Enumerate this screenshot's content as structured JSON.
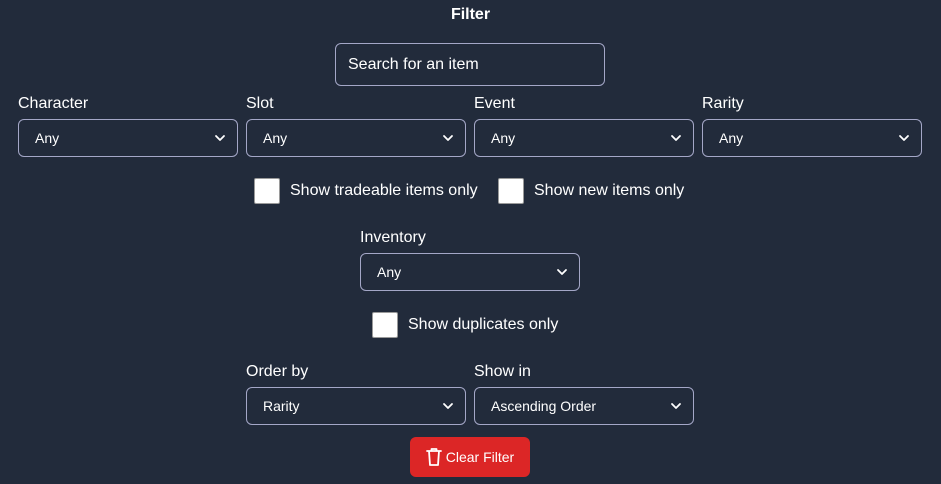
{
  "title": "Filter",
  "search": {
    "placeholder": "Search for an item",
    "value": ""
  },
  "filters": {
    "character": {
      "label": "Character",
      "value": "Any"
    },
    "slot": {
      "label": "Slot",
      "value": "Any"
    },
    "event": {
      "label": "Event",
      "value": "Any"
    },
    "rarity": {
      "label": "Rarity",
      "value": "Any"
    }
  },
  "checkboxes": {
    "tradeable": {
      "label": "Show tradeable items only",
      "checked": false
    },
    "new_items": {
      "label": "Show new items only",
      "checked": false
    },
    "duplicates": {
      "label": "Show duplicates only",
      "checked": false
    }
  },
  "inventory": {
    "label": "Inventory",
    "value": "Any"
  },
  "order_by": {
    "label": "Order by",
    "value": "Rarity"
  },
  "show_in": {
    "label": "Show in",
    "value": "Ascending Order"
  },
  "clear_button": {
    "label": "Clear Filter",
    "icon": "trash-icon",
    "color": "#dc2626"
  },
  "colors": {
    "background": "#222b3b",
    "border": "#a4a7c7",
    "text": "#ffffff"
  }
}
